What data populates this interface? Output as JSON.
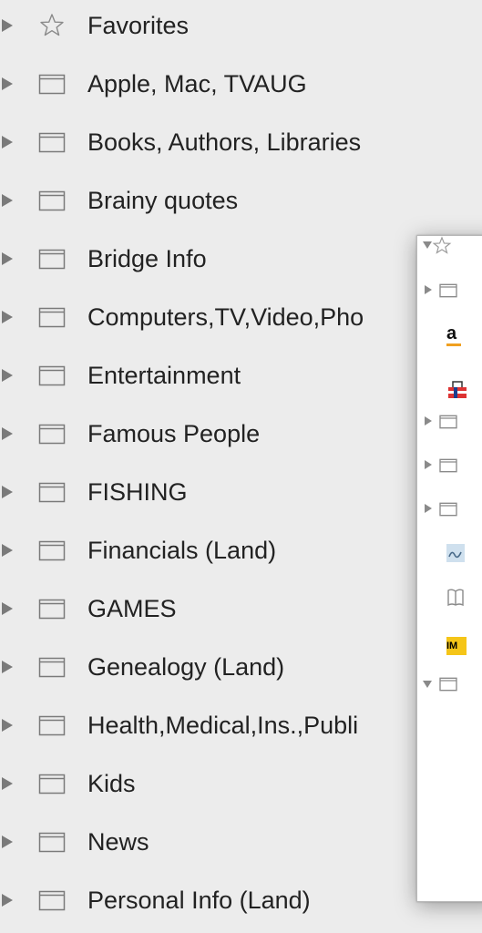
{
  "bookmarks": {
    "items": [
      {
        "label": "Favorites",
        "icon": "star-icon"
      },
      {
        "label": "Apple, Mac, TVAUG",
        "icon": "folder-icon"
      },
      {
        "label": "Books, Authors, Libraries",
        "icon": "folder-icon"
      },
      {
        "label": "Brainy quotes",
        "icon": "folder-icon"
      },
      {
        "label": "Bridge Info",
        "icon": "folder-icon"
      },
      {
        "label": "Computers,TV,Video,Pho",
        "icon": "folder-icon"
      },
      {
        "label": "Entertainment",
        "icon": "folder-icon"
      },
      {
        "label": "Famous People",
        "icon": "folder-icon"
      },
      {
        "label": "FISHING",
        "icon": "folder-icon"
      },
      {
        "label": "Financials (Land)",
        "icon": "folder-icon"
      },
      {
        "label": "GAMES",
        "icon": "folder-icon"
      },
      {
        "label": "Genealogy (Land)",
        "icon": "folder-icon"
      },
      {
        "label": "Health,Medical,Ins.,Publi",
        "icon": "folder-icon"
      },
      {
        "label": "Kids",
        "icon": "folder-icon"
      },
      {
        "label": "News",
        "icon": "folder-icon"
      },
      {
        "label": "Personal Info (Land)",
        "icon": "folder-icon"
      }
    ]
  },
  "secondary_window": {
    "favicon_amazon_letter": "a",
    "favicon_imdb_letters": "IM"
  }
}
